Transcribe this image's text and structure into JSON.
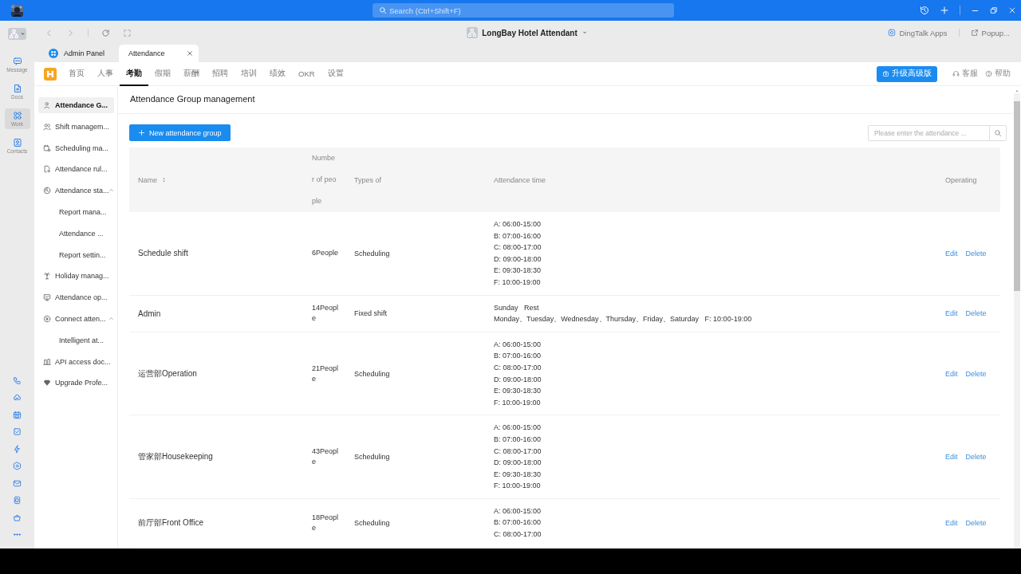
{
  "title_bar": {
    "search_placeholder": "Search (Ctrl+Shift+F)"
  },
  "rail": [
    {
      "label": "Message",
      "selected": false
    },
    {
      "label": "Docs",
      "selected": false
    },
    {
      "label": "Work",
      "selected": true
    },
    {
      "label": "Contacts",
      "selected": false
    }
  ],
  "toolbar": {
    "org_title": "LongBay Hotel Attendant",
    "apps_link": "DingTalk Apps",
    "popup_link": "Popup..."
  },
  "tabs": [
    {
      "label": "Admin Panel",
      "selected": false,
      "closable": false
    },
    {
      "label": "Attendance",
      "selected": true,
      "closable": true
    }
  ],
  "app_nav": {
    "items": [
      {
        "label": "首页",
        "selected": false
      },
      {
        "label": "人事",
        "selected": false
      },
      {
        "label": "考勤",
        "selected": true
      },
      {
        "label": "假期",
        "selected": false
      },
      {
        "label": "薪酬",
        "selected": false
      },
      {
        "label": "招聘",
        "selected": false
      },
      {
        "label": "培训",
        "selected": false
      },
      {
        "label": "绩效",
        "selected": false
      },
      {
        "label": "OKR",
        "selected": false
      },
      {
        "label": "设置",
        "selected": false
      }
    ],
    "upgrade_button": "升级高级版",
    "service": "客服",
    "help": "帮助"
  },
  "sidebar": [
    {
      "label": "Attendance G...",
      "selected": true
    },
    {
      "label": "Shift managem...",
      "selected": false
    },
    {
      "label": "Scheduling ma...",
      "selected": false
    },
    {
      "label": "Attendance rul...",
      "selected": false
    },
    {
      "label": "Attendance sta...",
      "selected": false,
      "expanded": true,
      "children": [
        {
          "label": "Report mana...",
          "selected": false
        },
        {
          "label": "Attendance ...",
          "selected": false
        },
        {
          "label": "Report settin...",
          "selected": false
        }
      ]
    },
    {
      "label": "Holiday manag...",
      "selected": false
    },
    {
      "label": "Attendance op...",
      "selected": false
    },
    {
      "label": "Connect atten...",
      "selected": false,
      "expanded": true,
      "children": [
        {
          "label": "Intelligent at...",
          "selected": false
        }
      ]
    },
    {
      "label": "API access doc...",
      "selected": false
    },
    {
      "label": "Upgrade Profe...",
      "selected": false
    }
  ],
  "page": {
    "title": "Attendance Group management",
    "new_button": "New attendance group",
    "search_placeholder": "Please enter the attendance ..."
  },
  "table": {
    "columns": [
      "Name",
      "Number of people",
      "Types of",
      "Attendance time",
      "Operating"
    ],
    "rows": [
      {
        "name": "Schedule shift",
        "people": "6People",
        "type": "Scheduling",
        "times": [
          "A: 06:00-15:00",
          "B: 07:00-16:00",
          "C: 08:00-17:00",
          "D: 09:00-18:00",
          "E: 09:30-18:30",
          "F: 10:00-19:00"
        ],
        "actions": [
          "Edit",
          "Delete"
        ]
      },
      {
        "name": "Admin",
        "people": "14People",
        "type": "Fixed shift",
        "times": [
          "Sunday   Rest",
          "Monday、Tuesday、Wednesday、Thursday、Friday、Saturday   F: 10:00-19:00"
        ],
        "actions": [
          "Edit",
          "Delete"
        ]
      },
      {
        "name": "运营部Operation",
        "people": "21People",
        "type": "Scheduling",
        "times": [
          "A: 06:00-15:00",
          "B: 07:00-16:00",
          "C: 08:00-17:00",
          "D: 09:00-18:00",
          "E: 09:30-18:30",
          "F: 10:00-19:00"
        ],
        "actions": [
          "Edit",
          "Delete"
        ]
      },
      {
        "name": "管家部Housekeeping",
        "people": "43People",
        "type": "Scheduling",
        "times": [
          "A: 06:00-15:00",
          "B: 07:00-16:00",
          "C: 08:00-17:00",
          "D: 09:00-18:00",
          "E: 09:30-18:30",
          "F: 10:00-19:00"
        ],
        "actions": [
          "Edit",
          "Delete"
        ]
      },
      {
        "name": "前厅部Front Office",
        "people": "18People",
        "type": "Scheduling",
        "times": [
          "A: 06:00-15:00",
          "B: 07:00-16:00",
          "C: 08:00-17:00"
        ],
        "actions": [
          "Edit",
          "Delete"
        ]
      }
    ]
  }
}
